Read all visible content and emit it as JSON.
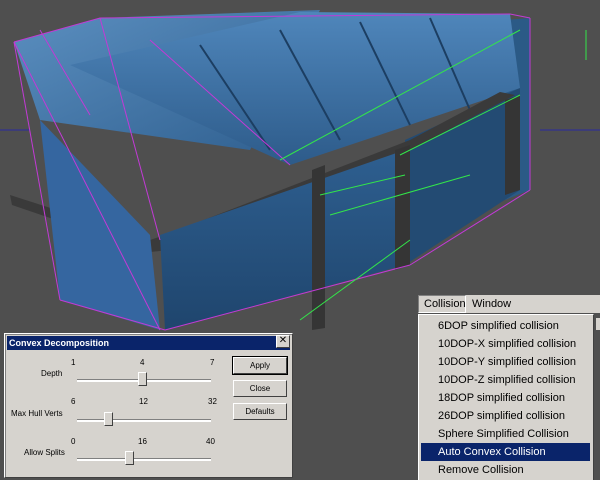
{
  "dialog": {
    "title": "Convex Decomposition",
    "sliders": [
      {
        "label": "Depth",
        "min": "1",
        "mid": "4",
        "max": "7",
        "value": 4
      },
      {
        "label": "Max Hull Verts",
        "min": "6",
        "mid": "12",
        "max": "32",
        "value": 10
      },
      {
        "label": "Allow Splits",
        "min": "0",
        "mid": "16",
        "max": "40",
        "value": 16
      }
    ],
    "buttons": {
      "apply": "Apply",
      "close": "Close",
      "defaults": "Defaults"
    }
  },
  "menubar": {
    "collision": "Collision",
    "window": "Window"
  },
  "menu": {
    "items": [
      "6DOP simplified collision",
      "10DOP-X simplified collision",
      "10DOP-Y simplified collision",
      "10DOP-Z simplified collision",
      "18DOP simplified collision",
      "26DOP simplified collision",
      "Sphere Simplified Collision",
      "Auto Convex Collision",
      "Remove Collision"
    ],
    "selected_index": 7
  },
  "colors": {
    "selection": "#0a246a",
    "dumpster": "#3b74a8",
    "wire_magenta": "#c23ad6",
    "wire_green": "#33e64a"
  }
}
